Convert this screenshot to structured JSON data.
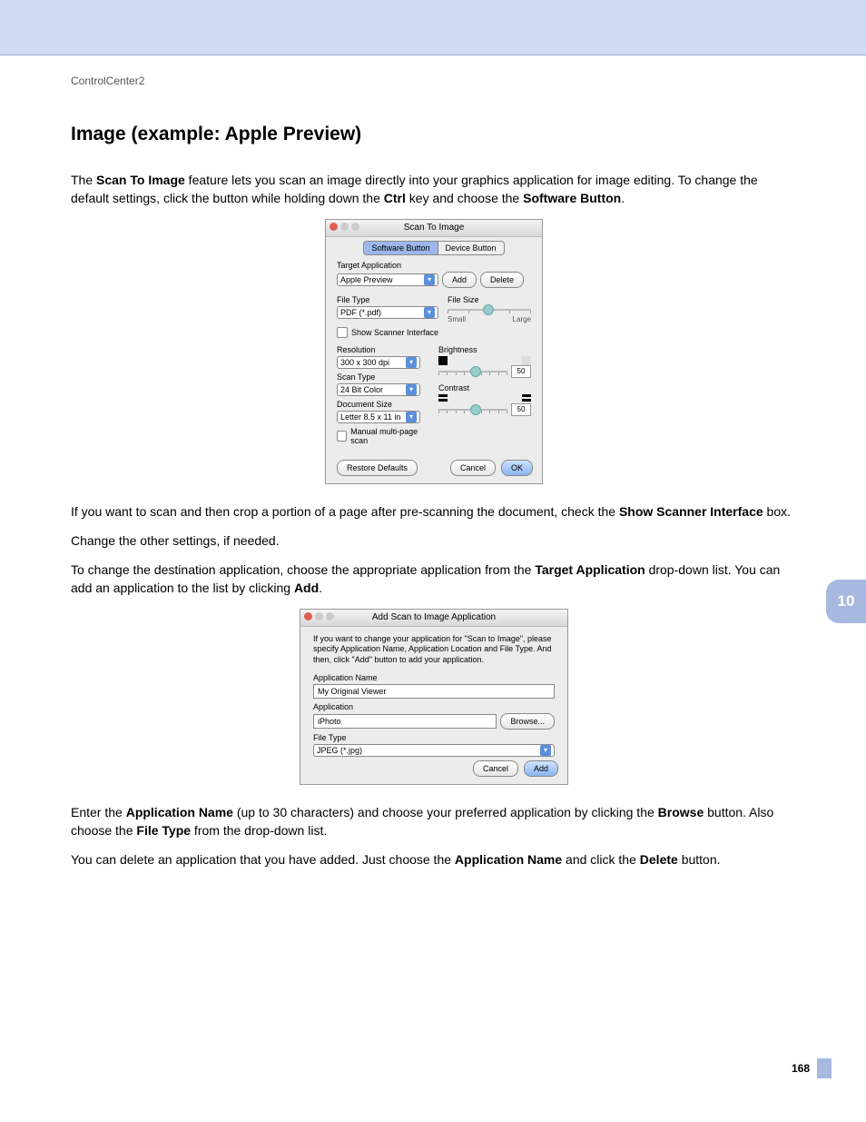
{
  "breadcrumb": "ControlCenter2",
  "heading": "Image (example: Apple Preview)",
  "chapter_number": "10",
  "page_number": "168",
  "para1": {
    "t1": "The ",
    "b1": "Scan To Image",
    "t2": " feature lets you scan an image directly into your graphics application for image editing. To change the default settings, click the button while holding down the ",
    "b2": "Ctrl",
    "t3": " key and choose the ",
    "b3": "Software Button",
    "t4": "."
  },
  "para2": {
    "t1": "If you want to scan and then crop a portion of a page after pre-scanning the document, check the ",
    "b1": "Show Scanner Interface",
    "t2": " box."
  },
  "para3": "Change the other settings, if needed.",
  "para4": {
    "t1": "To change the destination application, choose the appropriate application from the ",
    "b1": "Target Application",
    "t2": " drop-down list. You can add an application to the list by clicking ",
    "b2": "Add",
    "t3": "."
  },
  "para5": {
    "t1": "Enter the ",
    "b1": "Application Name",
    "t2": " (up to 30 characters) and choose your preferred application by clicking the ",
    "b2": "Browse",
    "t3": " button. Also choose the ",
    "b3": "File Type",
    "t4": " from the drop-down list."
  },
  "para6": {
    "t1": "You can delete an application that you have added. Just choose the ",
    "b1": "Application Name",
    "t2": " and click the ",
    "b2": "Delete",
    "t3": " button."
  },
  "dlg1": {
    "title": "Scan To Image",
    "tab_software": "Software Button",
    "tab_device": "Device Button",
    "target_app_label": "Target Application",
    "target_app_value": "Apple Preview",
    "add": "Add",
    "delete": "Delete",
    "file_type_label": "File Type",
    "file_type_value": "PDF (*.pdf)",
    "file_size_label": "File Size",
    "file_size_small": "Small",
    "file_size_large": "Large",
    "show_scanner": "Show Scanner Interface",
    "resolution_label": "Resolution",
    "resolution_value": "300 x 300 dpi",
    "scan_type_label": "Scan Type",
    "scan_type_value": "24 Bit Color",
    "doc_size_label": "Document Size",
    "doc_size_value": "Letter 8.5 x 11 in",
    "manual_multi": "Manual multi-page scan",
    "brightness_label": "Brightness",
    "brightness_value": "50",
    "contrast_label": "Contrast",
    "contrast_value": "50",
    "restore": "Restore Defaults",
    "cancel": "Cancel",
    "ok": "OK"
  },
  "dlg2": {
    "title": "Add Scan to Image Application",
    "instructions": "If you want to change your application for \"Scan to Image\", please specify Application Name, Application Location and File Type. And then, click \"Add\" button to add your application.",
    "app_name_label": "Application Name",
    "app_name_value": "My Original Viewer",
    "application_label": "Application",
    "application_value": "iPhoto",
    "browse": "Browse...",
    "file_type_label": "File Type",
    "file_type_value": "JPEG (*.jpg)",
    "cancel": "Cancel",
    "add": "Add"
  }
}
